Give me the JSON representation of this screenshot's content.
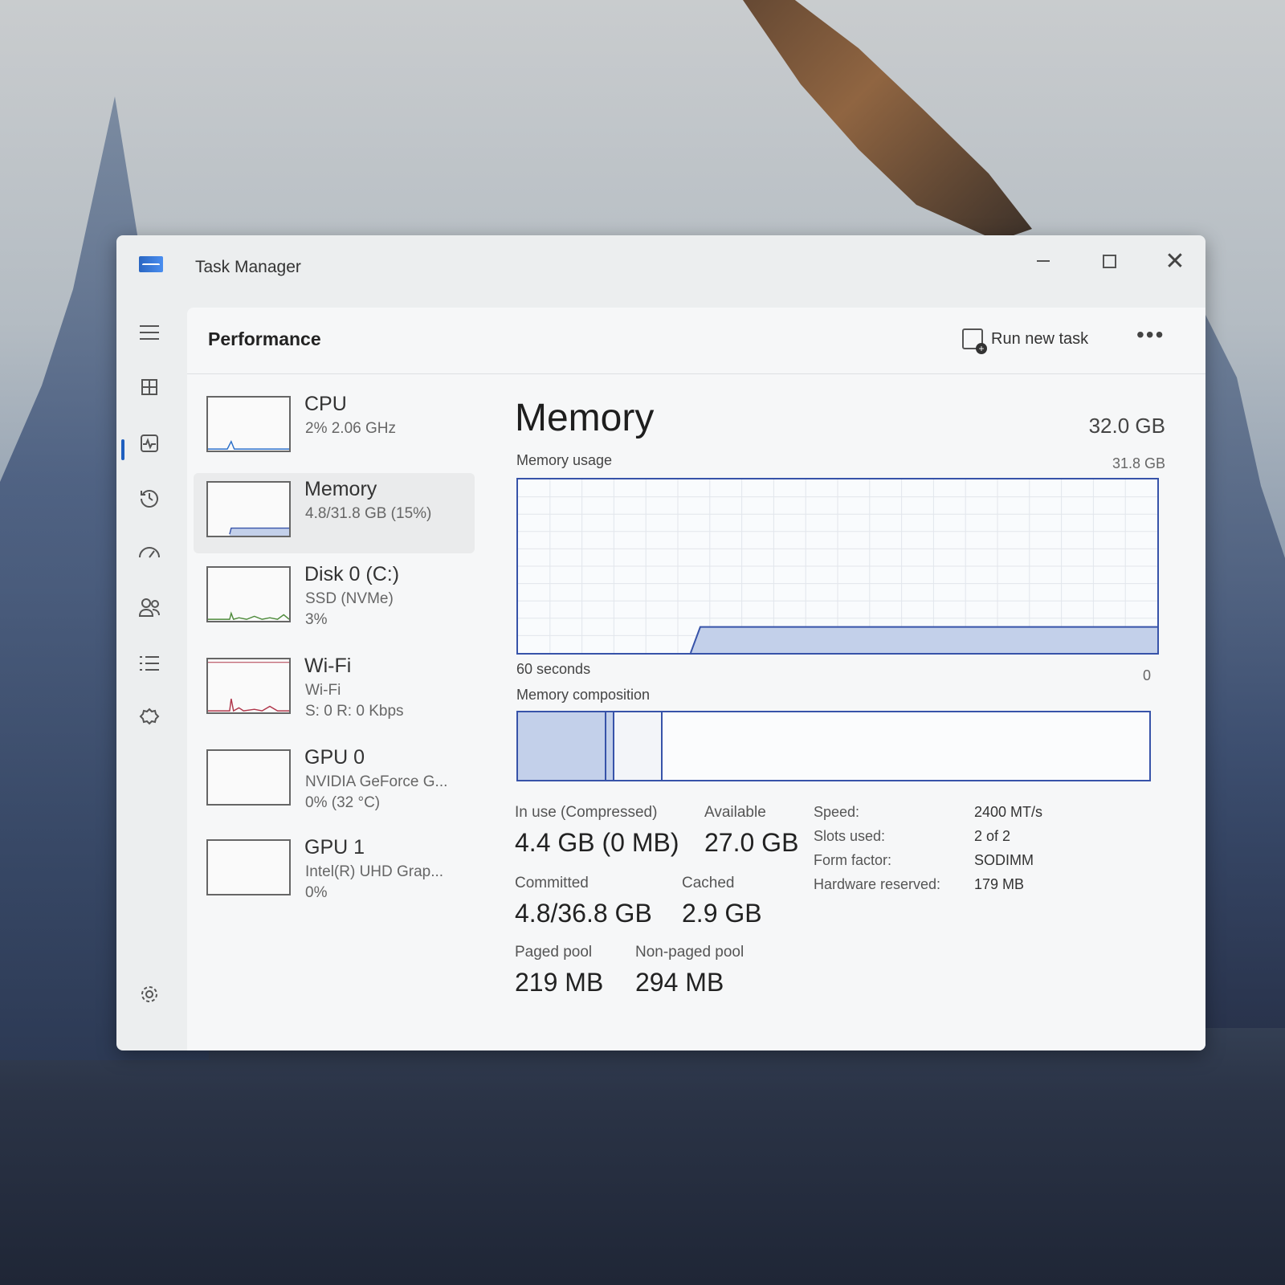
{
  "window": {
    "title": "Task Manager"
  },
  "titlebar": {
    "minimize": "—",
    "maximize": "☐",
    "close": "✕"
  },
  "nav": {
    "menu_icon": "hamburger-icon",
    "items": [
      {
        "name": "processes",
        "icon": "grid-icon",
        "glyph": "⊞"
      },
      {
        "name": "performance",
        "icon": "activity-icon",
        "glyph": "⎍"
      },
      {
        "name": "app-history",
        "icon": "history-icon",
        "glyph": "↺"
      },
      {
        "name": "startup-apps",
        "icon": "gauge-icon",
        "glyph": "⌁"
      },
      {
        "name": "users",
        "icon": "users-icon",
        "glyph": "👥"
      },
      {
        "name": "details",
        "icon": "list-icon",
        "glyph": "☰"
      },
      {
        "name": "services",
        "icon": "puzzle-icon",
        "glyph": "⚙"
      }
    ],
    "settings_glyph": "⚙"
  },
  "header": {
    "title": "Performance",
    "run_task": "Run new task",
    "more": "•••"
  },
  "devices": [
    {
      "name": "CPU",
      "sub1": "2%  2.06 GHz",
      "sub2": ""
    },
    {
      "name": "Memory",
      "sub1": "4.8/31.8 GB (15%)",
      "sub2": ""
    },
    {
      "name": "Disk 0 (C:)",
      "sub1": "SSD (NVMe)",
      "sub2": "3%"
    },
    {
      "name": "Wi-Fi",
      "sub1": "Wi-Fi",
      "sub2": "S: 0 R: 0 Kbps"
    },
    {
      "name": "GPU 0",
      "sub1": "NVIDIA GeForce G...",
      "sub2": "0% (32 °C)"
    },
    {
      "name": "GPU 1",
      "sub1": "Intel(R) UHD Grap...",
      "sub2": "0%"
    }
  ],
  "memory": {
    "title": "Memory",
    "total": "32.0 GB",
    "usage_label": "Memory usage",
    "usage_max": "31.8 GB",
    "axis_left": "60 seconds",
    "axis_right": "0",
    "composition_label": "Memory composition",
    "usage_fraction": 0.15,
    "stats": {
      "in_use_label": "In use (Compressed)",
      "in_use_value": "4.4 GB (0 MB)",
      "available_label": "Available",
      "available_value": "27.0 GB",
      "committed_label": "Committed",
      "committed_value": "4.8/36.8 GB",
      "cached_label": "Cached",
      "cached_value": "2.9 GB",
      "paged_label": "Paged pool",
      "paged_value": "219 MB",
      "nonpaged_label": "Non-paged pool",
      "nonpaged_value": "294 MB"
    },
    "specs": [
      {
        "key": "Speed:",
        "value": "2400 MT/s"
      },
      {
        "key": "Slots used:",
        "value": "2 of 2"
      },
      {
        "key": "Form factor:",
        "value": "SODIMM"
      },
      {
        "key": "Hardware reserved:",
        "value": "179 MB"
      }
    ]
  },
  "colors": {
    "accent": "#3753a9",
    "fill": "#c3d0ea",
    "cpu_line": "#2a6fc9",
    "disk_line": "#4d8a3a",
    "wifi_line": "#b0364b"
  }
}
